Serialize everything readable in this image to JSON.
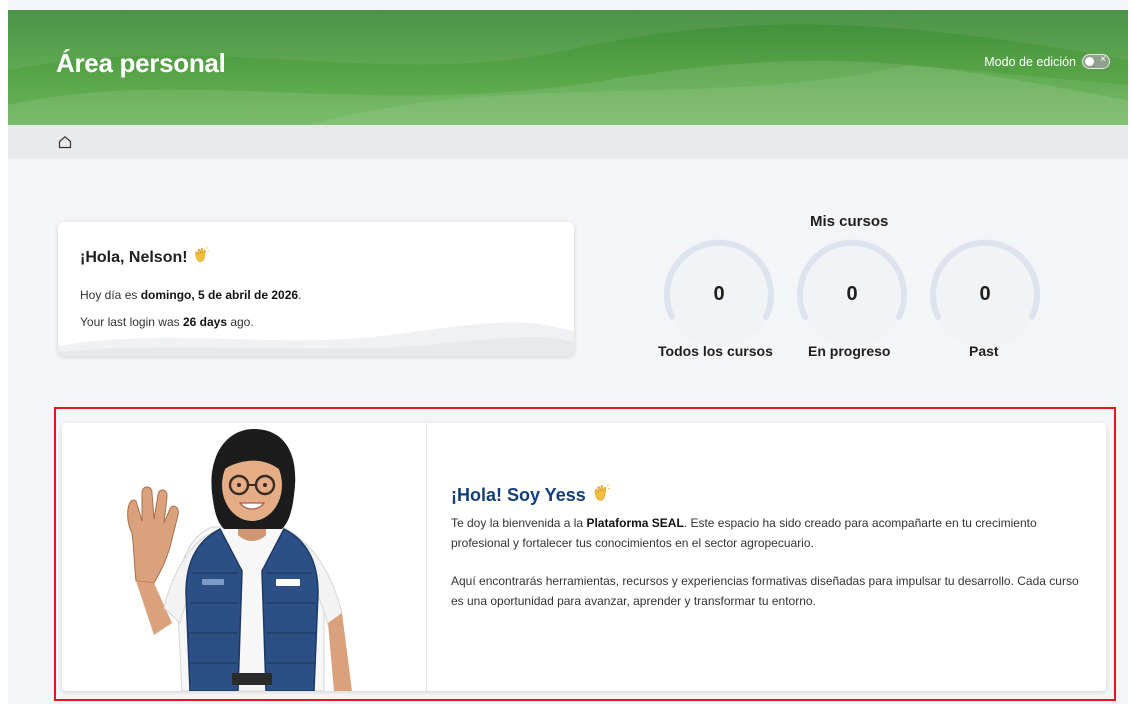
{
  "header": {
    "title": "Área personal",
    "edit_mode_label": "Modo de edición",
    "edit_mode_on": false
  },
  "breadcrumb": {
    "home_icon": "home-icon"
  },
  "greeting": {
    "title": "¡Hola, Nelson!",
    "date_prefix": "Hoy día es ",
    "date_value": "domingo, 5 de abril de 2026",
    "date_suffix": ".",
    "login_prefix": "Your last login was ",
    "login_value": "26 days",
    "login_suffix": " ago."
  },
  "courses": {
    "title": "Mis cursos",
    "stats": [
      {
        "label": "Todos los cursos",
        "value": "0"
      },
      {
        "label": "En progreso",
        "value": "0"
      },
      {
        "label": "Past",
        "value": "0"
      }
    ]
  },
  "welcome": {
    "title": "¡Hola! Soy Yess",
    "p1_prefix": "Te doy la bienvenida a la ",
    "p1_bold": "Plataforma SEAL",
    "p1_suffix": ". Este espacio ha sido creado para acompañarte en tu crecimiento profesional y fortalecer tus conocimientos en el sector agropecuario.",
    "p2": "Aquí encontrarás herramientas, recursos y experiencias formativas diseñadas para impulsar tu desarrollo. Cada curso es una oportunidad para avanzar, aprender y transformar tu entorno."
  },
  "colors": {
    "header_green": "#4f9c44",
    "highlight_border": "#e1191e",
    "welcome_title": "#123e7c",
    "vest_blue": "#2c4f86"
  }
}
